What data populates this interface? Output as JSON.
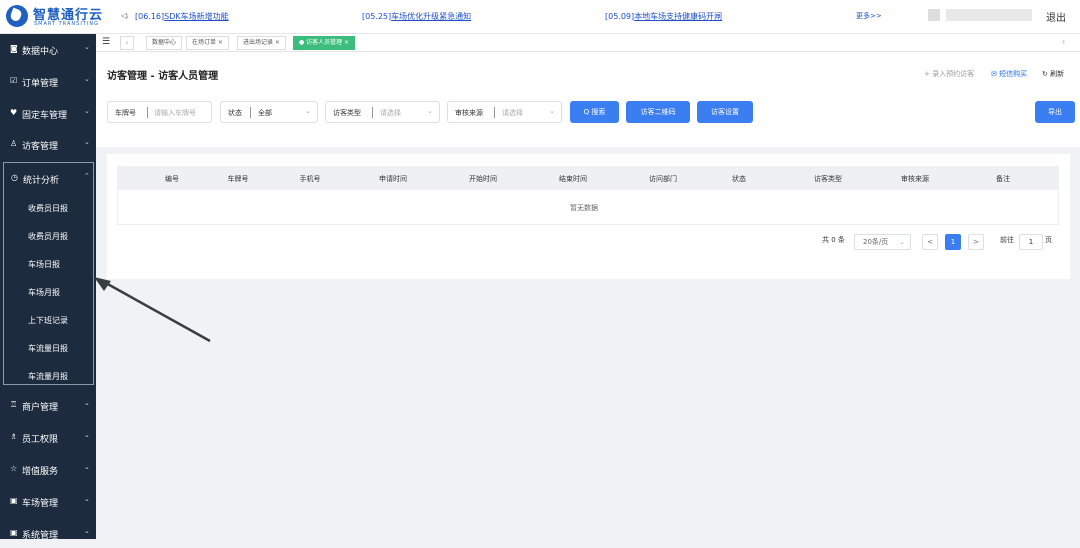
{
  "header": {
    "logo_name": "智慧通行云",
    "logo_sub": "SMART TRANSITING",
    "notices": [
      {
        "date": "[06.16]",
        "text": "SDK车场新增功能"
      },
      {
        "date": "[05.25]",
        "text": "车场优化升级紧急通知"
      },
      {
        "date": "[05.09]",
        "text": "本地车场支持健康码开闸"
      }
    ],
    "more": "更多>>",
    "logout": "退出",
    "icons": {
      "speaker": "speaker-icon"
    }
  },
  "sidebar": {
    "items": [
      {
        "icon": "◙",
        "label": "数据中心"
      },
      {
        "icon": "☑",
        "label": "订单管理"
      },
      {
        "icon": "♥",
        "label": "固定车管理"
      },
      {
        "icon": "♙",
        "label": "访客管理"
      },
      {
        "icon": "◷",
        "label": "统计分析"
      },
      {
        "icon": "♖",
        "label": "商户管理"
      },
      {
        "icon": "♗",
        "label": "员工权限"
      },
      {
        "icon": "☆",
        "label": "增值服务"
      },
      {
        "icon": "▣",
        "label": "车场管理"
      },
      {
        "icon": "▣",
        "label": "系统管理"
      }
    ],
    "submenu": [
      "收费员日报",
      "收费员月报",
      "车场日报",
      "车场月报",
      "上下班记录",
      "车流量日报",
      "车流量月报"
    ]
  },
  "tabs": [
    {
      "label": "数据中心"
    },
    {
      "label": "在场订单 ×"
    },
    {
      "label": "进出场记录 ×"
    },
    {
      "label": "● 访客人员管理 ×"
    }
  ],
  "page": {
    "title": "访客管理 - 访客人员管理",
    "links": {
      "add": "+ 录入预约访客",
      "sms": "✉ 短信购买",
      "refresh": "↻ 刷新"
    }
  },
  "filters": {
    "plate": {
      "label": "车牌号",
      "placeholder": "请输入车牌号"
    },
    "status": {
      "label": "状态",
      "value": "全部"
    },
    "visitor_type": {
      "label": "访客类型",
      "placeholder": "请选择"
    },
    "source": {
      "label": "审核来源",
      "placeholder": "请选择"
    }
  },
  "buttons": {
    "search": "Q 搜索",
    "qrcode": "访客二维码",
    "settings": "访客设置",
    "export": "导出"
  },
  "table": {
    "columns": [
      "编号",
      "车牌号",
      "手机号",
      "申请时间",
      "开始时间",
      "结束时间",
      "访问部门",
      "状态",
      "访客类型",
      "审核来源",
      "备注"
    ],
    "empty": "暂无数据"
  },
  "pagination": {
    "total": "共 0 条",
    "page_size": "20条/页",
    "current": "1",
    "goto_label": "前往",
    "goto_value": "1",
    "goto_unit": "页",
    "prev": "<",
    "next": ">"
  },
  "colors": {
    "accent": "#3a7ef2",
    "sidebar": "#1c2b3d",
    "tab_active": "#3dbd7d",
    "link": "#1f4fcf"
  }
}
